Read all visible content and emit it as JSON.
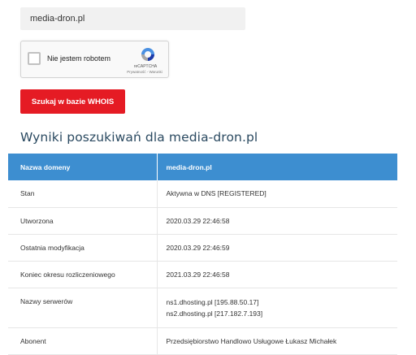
{
  "search": {
    "domain_value": "media-dron.pl",
    "button_label": "Szukaj w bazie WHOIS"
  },
  "captcha": {
    "label": "Nie jestem robotem",
    "brand": "reCAPTCHA",
    "links": "Prywatność - Warunki"
  },
  "results": {
    "title": "Wyniki poszukiwań dla media-dron.pl",
    "header": {
      "name_col": "Nazwa domeny",
      "value_col": "media-dron.pl"
    },
    "rows": [
      {
        "label": "Stan",
        "value": "Aktywna w DNS [REGISTERED]"
      },
      {
        "label": "Utworzona",
        "value": "2020.03.29 22:46:58"
      },
      {
        "label": "Ostatnia modyfikacja",
        "value": "2020.03.29 22:46:59"
      },
      {
        "label": "Koniec okresu rozliczeniowego",
        "value": "2021.03.29 22:46:58"
      },
      {
        "label": "Nazwy serwerów",
        "values": [
          "ns1.dhosting.pl [195.88.50.17]",
          "ns2.dhosting.pl [217.182.7.193]"
        ]
      },
      {
        "label": "Abonent",
        "value": "Przedsiębiorstwo Handlowo Usługowe Łukasz Michałek"
      }
    ]
  },
  "colors": {
    "button": "#e51b24",
    "table_header": "#3d8ed0",
    "title": "#2b4a61"
  }
}
